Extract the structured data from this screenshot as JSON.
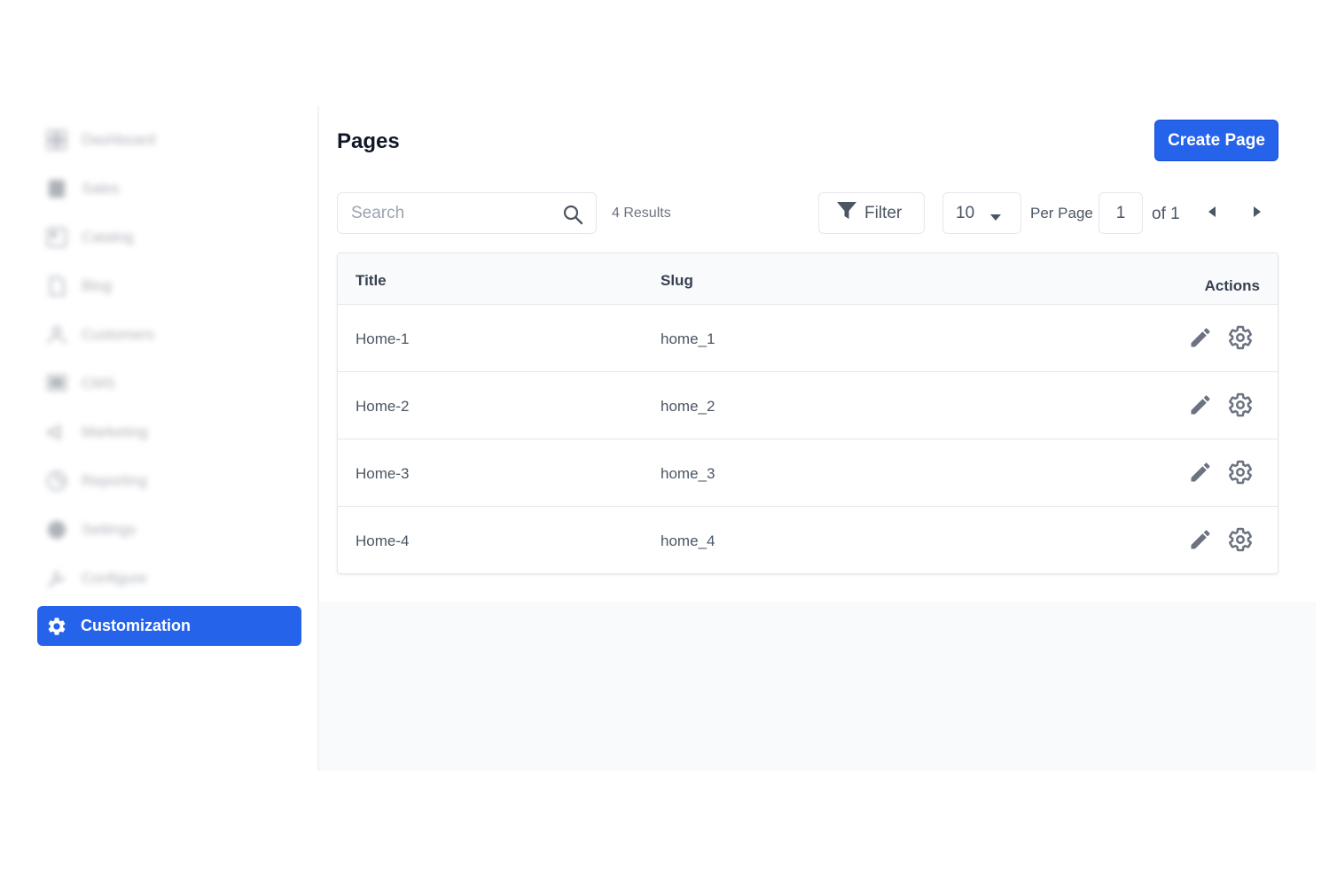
{
  "sidebar": {
    "items": [
      {
        "label": "Dashboard",
        "icon": "dashboard-icon"
      },
      {
        "label": "Sales",
        "icon": "sales-icon"
      },
      {
        "label": "Catalog",
        "icon": "catalog-icon"
      },
      {
        "label": "Blog",
        "icon": "blog-icon"
      },
      {
        "label": "Customers",
        "icon": "customers-icon"
      },
      {
        "label": "CMS",
        "icon": "cms-icon"
      },
      {
        "label": "Marketing",
        "icon": "marketing-icon"
      },
      {
        "label": "Reporting",
        "icon": "reporting-icon"
      },
      {
        "label": "Settings",
        "icon": "settings-icon"
      },
      {
        "label": "Configure",
        "icon": "configure-icon"
      },
      {
        "label": "Customization",
        "icon": "gear-icon",
        "active": true
      }
    ]
  },
  "header": {
    "title": "Pages",
    "create_label": "Create Page"
  },
  "toolbar": {
    "search_placeholder": "Search",
    "results": "4 Results",
    "filter_label": "Filter",
    "per_page_value": "10",
    "per_page_label": "Per Page",
    "page_value": "1",
    "of_label": "of 1"
  },
  "table": {
    "columns": [
      "Title",
      "Slug",
      "Actions"
    ],
    "rows": [
      {
        "title": "Home-1",
        "slug": "home_1"
      },
      {
        "title": "Home-2",
        "slug": "home_2"
      },
      {
        "title": "Home-3",
        "slug": "home_3"
      },
      {
        "title": "Home-4",
        "slug": "home_4"
      }
    ]
  },
  "colors": {
    "accent": "#2563eb",
    "icon_gray": "#6b7280",
    "border": "#e5e7eb"
  }
}
